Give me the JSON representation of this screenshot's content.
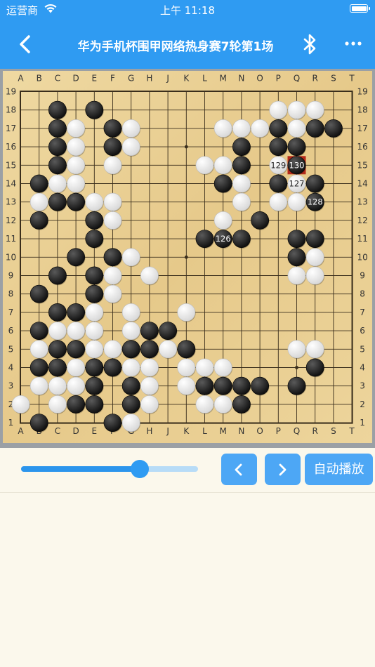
{
  "status_bar": {
    "carrier": "运营商",
    "time": "上午 11:18",
    "battery_level": 1.0
  },
  "nav": {
    "title": "华为手机杯围甲网络热身赛7轮第1场",
    "icons": {
      "back": "chevron-left-icon",
      "bluetooth": "bluetooth-icon",
      "more": "more-icon"
    }
  },
  "board": {
    "size": 19,
    "columns": [
      "A",
      "B",
      "C",
      "D",
      "E",
      "F",
      "G",
      "H",
      "J",
      "K",
      "L",
      "M",
      "N",
      "O",
      "P",
      "Q",
      "R",
      "S",
      "T"
    ],
    "rows": [
      "19",
      "18",
      "17",
      "16",
      "15",
      "14",
      "13",
      "12",
      "11",
      "10",
      "9",
      "8",
      "7",
      "6",
      "5",
      "4",
      "3",
      "2",
      "1"
    ],
    "stones": [
      {
        "c": "black",
        "p": "C18"
      },
      {
        "c": "black",
        "p": "E18"
      },
      {
        "c": "white",
        "p": "P18"
      },
      {
        "c": "white",
        "p": "Q18"
      },
      {
        "c": "white",
        "p": "R18"
      },
      {
        "c": "black",
        "p": "C17"
      },
      {
        "c": "white",
        "p": "D17"
      },
      {
        "c": "black",
        "p": "F17"
      },
      {
        "c": "white",
        "p": "G17"
      },
      {
        "c": "white",
        "p": "M17"
      },
      {
        "c": "white",
        "p": "N17"
      },
      {
        "c": "white",
        "p": "O17"
      },
      {
        "c": "black",
        "p": "P17"
      },
      {
        "c": "white",
        "p": "Q17"
      },
      {
        "c": "black",
        "p": "R17"
      },
      {
        "c": "black",
        "p": "S17"
      },
      {
        "c": "black",
        "p": "C16"
      },
      {
        "c": "white",
        "p": "D16"
      },
      {
        "c": "black",
        "p": "F16"
      },
      {
        "c": "white",
        "p": "G16"
      },
      {
        "c": "black",
        "p": "N16"
      },
      {
        "c": "black",
        "p": "P16"
      },
      {
        "c": "black",
        "p": "Q16"
      },
      {
        "c": "black",
        "p": "C15"
      },
      {
        "c": "white",
        "p": "D15"
      },
      {
        "c": "white",
        "p": "F15"
      },
      {
        "c": "white",
        "p": "L15"
      },
      {
        "c": "white",
        "p": "M15"
      },
      {
        "c": "black",
        "p": "N15"
      },
      {
        "c": "white",
        "p": "P15",
        "n": "129"
      },
      {
        "c": "black",
        "p": "Q15",
        "n": "130",
        "last": true
      },
      {
        "c": "black",
        "p": "B14"
      },
      {
        "c": "white",
        "p": "C14"
      },
      {
        "c": "white",
        "p": "D14"
      },
      {
        "c": "black",
        "p": "M14"
      },
      {
        "c": "white",
        "p": "N14"
      },
      {
        "c": "black",
        "p": "P14"
      },
      {
        "c": "white",
        "p": "Q14",
        "n": "127"
      },
      {
        "c": "black",
        "p": "R14"
      },
      {
        "c": "white",
        "p": "B13"
      },
      {
        "c": "black",
        "p": "C13"
      },
      {
        "c": "black",
        "p": "D13"
      },
      {
        "c": "white",
        "p": "E13"
      },
      {
        "c": "white",
        "p": "F13"
      },
      {
        "c": "white",
        "p": "N13"
      },
      {
        "c": "white",
        "p": "P13"
      },
      {
        "c": "white",
        "p": "Q13"
      },
      {
        "c": "black",
        "p": "R13",
        "n": "128"
      },
      {
        "c": "black",
        "p": "B12"
      },
      {
        "c": "black",
        "p": "E12"
      },
      {
        "c": "white",
        "p": "F12"
      },
      {
        "c": "white",
        "p": "M12"
      },
      {
        "c": "black",
        "p": "O12"
      },
      {
        "c": "black",
        "p": "E11"
      },
      {
        "c": "black",
        "p": "L11"
      },
      {
        "c": "black",
        "p": "M11",
        "n": "126"
      },
      {
        "c": "black",
        "p": "N11"
      },
      {
        "c": "black",
        "p": "Q11"
      },
      {
        "c": "black",
        "p": "R11"
      },
      {
        "c": "black",
        "p": "D10"
      },
      {
        "c": "black",
        "p": "F10"
      },
      {
        "c": "white",
        "p": "G10"
      },
      {
        "c": "black",
        "p": "Q10"
      },
      {
        "c": "white",
        "p": "R10"
      },
      {
        "c": "black",
        "p": "C9"
      },
      {
        "c": "black",
        "p": "E9"
      },
      {
        "c": "white",
        "p": "F9"
      },
      {
        "c": "white",
        "p": "H9"
      },
      {
        "c": "white",
        "p": "Q9"
      },
      {
        "c": "white",
        "p": "R9"
      },
      {
        "c": "black",
        "p": "B8"
      },
      {
        "c": "black",
        "p": "E8"
      },
      {
        "c": "white",
        "p": "F8"
      },
      {
        "c": "black",
        "p": "C7"
      },
      {
        "c": "black",
        "p": "D7"
      },
      {
        "c": "white",
        "p": "E7"
      },
      {
        "c": "white",
        "p": "G7"
      },
      {
        "c": "white",
        "p": "K7"
      },
      {
        "c": "black",
        "p": "B6"
      },
      {
        "c": "white",
        "p": "C6"
      },
      {
        "c": "white",
        "p": "D6"
      },
      {
        "c": "white",
        "p": "E6"
      },
      {
        "c": "white",
        "p": "G6"
      },
      {
        "c": "black",
        "p": "H6"
      },
      {
        "c": "black",
        "p": "J6"
      },
      {
        "c": "white",
        "p": "B5"
      },
      {
        "c": "black",
        "p": "C5"
      },
      {
        "c": "black",
        "p": "D5"
      },
      {
        "c": "white",
        "p": "E5"
      },
      {
        "c": "white",
        "p": "F5"
      },
      {
        "c": "black",
        "p": "G5"
      },
      {
        "c": "black",
        "p": "H5"
      },
      {
        "c": "white",
        "p": "J5"
      },
      {
        "c": "black",
        "p": "K5"
      },
      {
        "c": "white",
        "p": "Q5"
      },
      {
        "c": "white",
        "p": "R5"
      },
      {
        "c": "black",
        "p": "B4"
      },
      {
        "c": "black",
        "p": "C4"
      },
      {
        "c": "white",
        "p": "D4"
      },
      {
        "c": "black",
        "p": "E4"
      },
      {
        "c": "black",
        "p": "F4"
      },
      {
        "c": "white",
        "p": "G4"
      },
      {
        "c": "white",
        "p": "H4"
      },
      {
        "c": "white",
        "p": "K4"
      },
      {
        "c": "white",
        "p": "L4"
      },
      {
        "c": "white",
        "p": "M4"
      },
      {
        "c": "black",
        "p": "R4"
      },
      {
        "c": "white",
        "p": "B3"
      },
      {
        "c": "white",
        "p": "C3"
      },
      {
        "c": "white",
        "p": "D3"
      },
      {
        "c": "black",
        "p": "E3"
      },
      {
        "c": "black",
        "p": "G3"
      },
      {
        "c": "white",
        "p": "H3"
      },
      {
        "c": "white",
        "p": "K3"
      },
      {
        "c": "black",
        "p": "L3"
      },
      {
        "c": "black",
        "p": "M3"
      },
      {
        "c": "black",
        "p": "N3"
      },
      {
        "c": "black",
        "p": "O3"
      },
      {
        "c": "black",
        "p": "Q3"
      },
      {
        "c": "white",
        "p": "A2"
      },
      {
        "c": "white",
        "p": "C2"
      },
      {
        "c": "black",
        "p": "D2"
      },
      {
        "c": "black",
        "p": "E2"
      },
      {
        "c": "black",
        "p": "G2"
      },
      {
        "c": "white",
        "p": "H2"
      },
      {
        "c": "white",
        "p": "L2"
      },
      {
        "c": "white",
        "p": "M2"
      },
      {
        "c": "black",
        "p": "N2"
      },
      {
        "c": "black",
        "p": "B1"
      },
      {
        "c": "black",
        "p": "F1"
      },
      {
        "c": "white",
        "p": "G1"
      }
    ],
    "colors": {
      "wood": "#e9cf93",
      "line": "#3a2e1c",
      "black": "#262626",
      "white": "#ececec",
      "last_move": "#b42a1a",
      "frame": "#9ba0a5"
    }
  },
  "controls": {
    "progress": 0.67,
    "prev_icon": "chevron-left-icon",
    "next_icon": "chevron-right-icon",
    "auto_play_label": "自动播放"
  }
}
